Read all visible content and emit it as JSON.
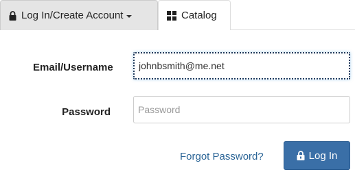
{
  "nav": {
    "login_tab": {
      "label": "Log In/Create Account",
      "icon": "lock-icon"
    },
    "catalog_tab": {
      "label": "Catalog",
      "icon": "grid-icon"
    }
  },
  "form": {
    "email": {
      "label": "Email/Username",
      "value": "johnbsmith@me.net"
    },
    "password": {
      "label": "Password",
      "placeholder": "Password",
      "value": ""
    },
    "forgot_link": "Forgot Password?",
    "login_button": {
      "label": "Log In",
      "icon": "lock-icon"
    }
  },
  "colors": {
    "accent": "#3a6fa7",
    "link": "#2a6496"
  }
}
